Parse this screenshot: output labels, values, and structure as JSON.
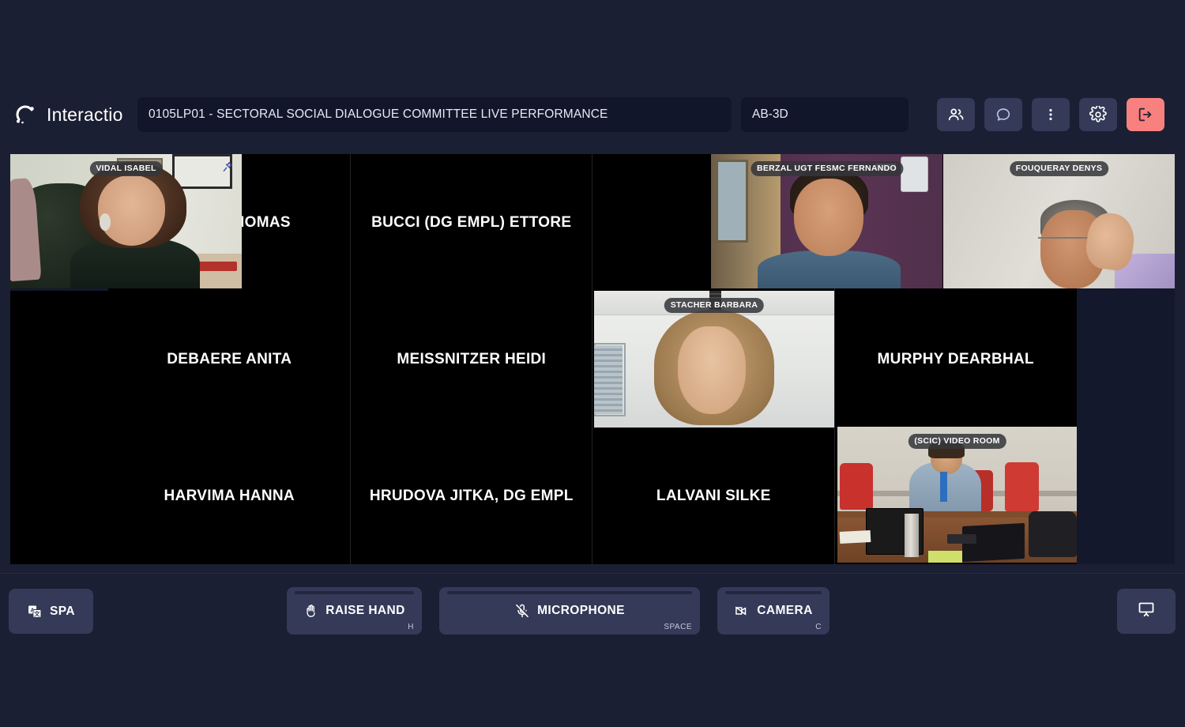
{
  "app": {
    "brand_name": "Interactio",
    "brand_icon": "interactio-logo-icon"
  },
  "header": {
    "meeting_title": "0105LP01 - SECTORAL SOCIAL DIALOGUE COMMITTEE LIVE PERFORMANCE",
    "room_code": "AB-3D",
    "buttons": [
      {
        "name": "participants",
        "icon": "people-icon"
      },
      {
        "name": "chat",
        "icon": "speech-bubble-icon"
      },
      {
        "name": "more-options",
        "icon": "three-dots-vertical-icon"
      },
      {
        "name": "settings",
        "icon": "gear-icon"
      },
      {
        "name": "leave-meeting",
        "icon": "exit-door-icon"
      }
    ],
    "leave_color": "#f8817f"
  },
  "grid": {
    "participants": [
      {
        "name": "VIDAL ISABEL",
        "video": true,
        "pinned": true
      },
      {
        "name": "DAYAN THOMAS",
        "video": false
      },
      {
        "name": "BUCCI (DG EMPL) ETTORE",
        "video": false
      },
      {
        "name": "BERZAL UGT FESMC FERNANDO",
        "video": true
      },
      {
        "name": "FOUQUERAY DENYS",
        "video": true
      },
      {
        "name": "DEBAERE ANITA",
        "video": false
      },
      {
        "name": "MEISSNITZER HEIDI",
        "video": false
      },
      {
        "name": "STACHER BARBARA",
        "video": true
      },
      {
        "name": "MURPHY DEARBHAL",
        "video": false
      },
      {
        "name": "HARVIMA HANNA",
        "video": false
      },
      {
        "name": "HRUDOVA JITKA, DG EMPL",
        "video": false
      },
      {
        "name": "LALVANI SILKE",
        "video": false
      },
      {
        "name": "(SCIC) VIDEO ROOM",
        "video": true
      }
    ]
  },
  "toolbar": {
    "language_label": "SPA",
    "language_icon": "translate-icon",
    "raise_hand_label": "RAISE HAND",
    "raise_hand_icon": "hand-icon",
    "raise_hand_shortcut": "H",
    "microphone_label": "MICROPHONE",
    "microphone_icon": "microphone-muted-icon",
    "microphone_shortcut": "SPACE",
    "camera_label": "CAMERA",
    "camera_icon": "camera-off-icon",
    "camera_shortcut": "C",
    "present_icon": "presentation-screen-icon"
  }
}
